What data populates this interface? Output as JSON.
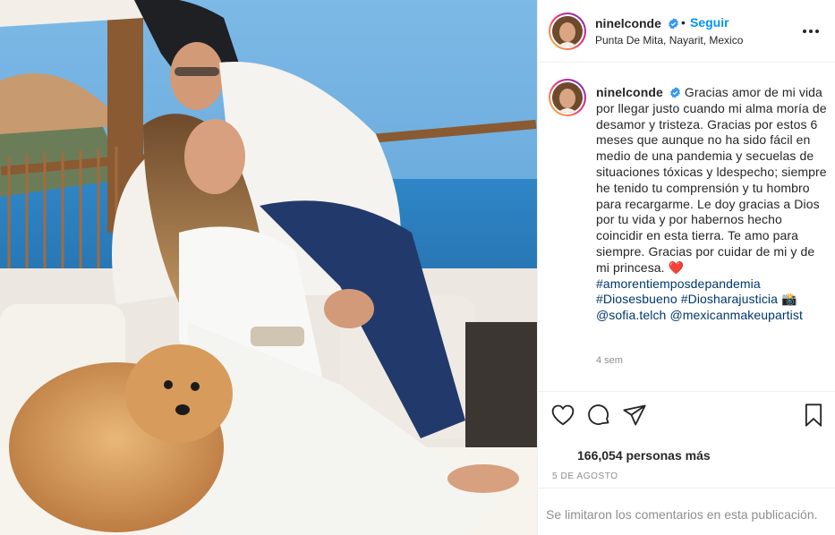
{
  "post": {
    "username": "ninelconde",
    "follow_label": "Seguir",
    "separator": "•",
    "location": "Punta De Mita, Nayarit, Mexico"
  },
  "caption": {
    "username": "ninelconde",
    "text": "Gracias amor de mi vida por llegar justo cuando mi alma moría de desamor y tristeza. Gracias por estos 6 meses que aunque no ha sido fácil en medio de una pandemia y secuelas de situaciones tóxicas y ldespecho; siempre he tenido tu comprensión y tu hombro para recargarme. Le doy gracias a Dios por tu vida y por habernos hecho coincidir en esta tierra. Te amo para siempre. Gracias por cuidar de mi y de mi princesa. ",
    "emoji_heart": "❤️",
    "hashtag_1": "#amorentiemposdepandemia",
    "hashtag_2": "#Diosesbueno",
    "hashtag_3": "#Diosharajusticia",
    "emoji_camera": "📸",
    "mention_1": "@sofia.telch",
    "mention_2": "@mexicanmakeupartist",
    "time": "4 sem"
  },
  "engagement": {
    "likes": "166,054 personas más",
    "date": "5 DE AGOSTO",
    "comments_limited": "Se limitaron los comentarios en esta publicación."
  },
  "icons": {
    "verified": "verified-badge-icon",
    "like": "heart-icon",
    "comment": "comment-icon",
    "share": "paper-plane-icon",
    "save": "bookmark-icon",
    "more": "more-options-icon"
  },
  "colors": {
    "accent": "#0095f6",
    "verified": "#3897f0",
    "hashtag": "#00376b",
    "muted": "#8e8e8e",
    "heart": "#ed4956"
  }
}
